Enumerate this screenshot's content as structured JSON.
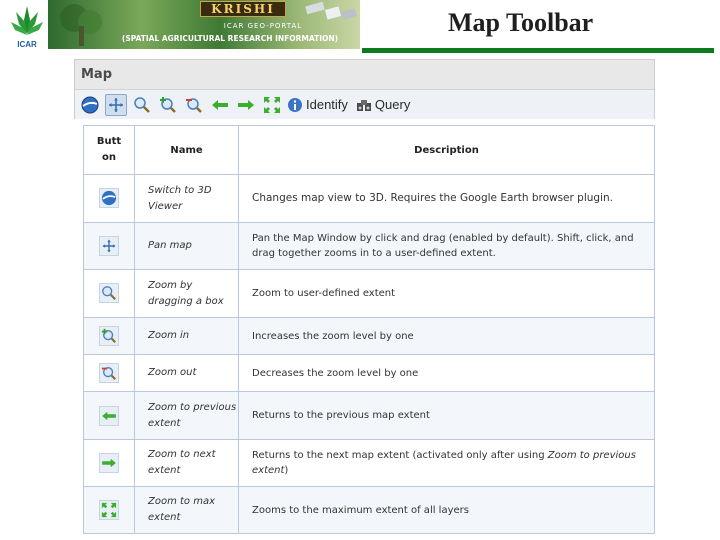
{
  "header": {
    "logo_caption": "ICAR",
    "banner_title": "KRISHI",
    "banner_subtitle": "ICAR GEO-PORTAL",
    "banner_tagline": "(SPATIAL AGRICULTURAL RESEARCH INFORMATION)",
    "slide_title": "Map Toolbar",
    "accent_color": "#0d7a1e"
  },
  "panel": {
    "title": "Map",
    "toolbar": {
      "identify_label": "Identify",
      "query_label": "Query"
    }
  },
  "table": {
    "columns": [
      "Butt on",
      "Name",
      "Description"
    ],
    "rows": [
      {
        "icon": "google-earth-icon",
        "name": "Switch to 3D Viewer",
        "description": "Changes map view to 3D. Requires the Google Earth browser plugin."
      },
      {
        "icon": "pan-icon",
        "name": "Pan map",
        "description": "Pan the Map Window by click and drag (enabled by default). Shift, click, and drag together zooms in to a user-defined extent."
      },
      {
        "icon": "zoom-box-icon",
        "name": "Zoom by dragging a box",
        "description": "Zoom to user-defined extent"
      },
      {
        "icon": "zoom-in-icon",
        "name": "Zoom in",
        "description": "Increases the zoom level by one"
      },
      {
        "icon": "zoom-out-icon",
        "name": "Zoom out",
        "description": "Decreases the zoom level by one"
      },
      {
        "icon": "arrow-left-icon",
        "name": "Zoom to previous extent",
        "description": "Returns to the previous map extent"
      },
      {
        "icon": "arrow-right-icon",
        "name": "Zoom to next extent",
        "description": "Returns to the next map extent (activated only after using ",
        "description_em": "Zoom to previous extent",
        "description_tail": ")"
      },
      {
        "icon": "zoom-max-icon",
        "name": "Zoom to max extent",
        "description": "Zooms to the maximum extent of all layers"
      }
    ]
  }
}
